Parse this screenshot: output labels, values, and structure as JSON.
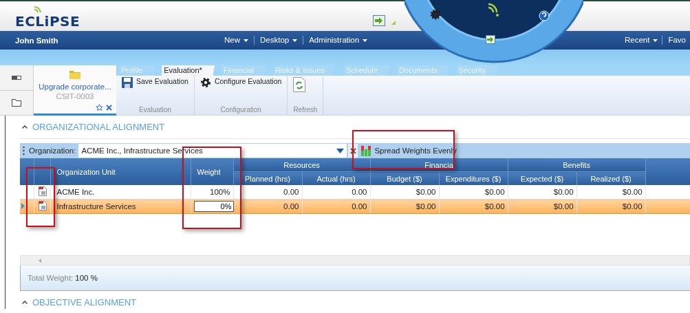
{
  "header": {
    "logo": "ECLiPSE"
  },
  "nav": {
    "user": "John Smith",
    "menus": [
      {
        "label": "New"
      },
      {
        "label": "Desktop"
      },
      {
        "label": "Administration"
      }
    ],
    "right_menus": [
      {
        "label": "Recent"
      },
      {
        "label": "Favo"
      }
    ]
  },
  "record": {
    "title": "Upgrade corporate...",
    "code": "CSIT-0003"
  },
  "tabs": [
    {
      "label": "Profile",
      "selected": false
    },
    {
      "label": "Evaluation*",
      "selected": true
    },
    {
      "label": "Financial",
      "selected": false
    },
    {
      "label": "Risks & Issues",
      "selected": false
    },
    {
      "label": "Schedule",
      "selected": false
    },
    {
      "label": "Documents",
      "selected": false
    },
    {
      "label": "Security",
      "selected": false
    }
  ],
  "ribbon_groups": [
    {
      "label": "Evaluation",
      "buttons": [
        {
          "label": "Save Evaluation",
          "kind": "save"
        }
      ]
    },
    {
      "label": "Configuration",
      "buttons": [
        {
          "label": "Configure Evaluation",
          "kind": "gear"
        }
      ]
    },
    {
      "label": "Refresh",
      "buttons": [
        {
          "kind": "refresh"
        }
      ]
    }
  ],
  "section": {
    "title": "ORGANIZATIONAL ALIGNMENT"
  },
  "toolbar": {
    "filter_label": "Organization:",
    "filter_value": "ACME Inc., Infrastructure Services",
    "action": "Spread Weights Evenly"
  },
  "table": {
    "columns": [
      {
        "label": "Organization Unit"
      },
      {
        "label": "Weight"
      },
      {
        "label": "Resources",
        "children": [
          {
            "label": "Planned (hrs)"
          },
          {
            "label": "Actual (hrs)"
          }
        ]
      },
      {
        "label": "Financia",
        "children": [
          {
            "label": "Budget ($)"
          },
          {
            "label": "Expenditures ($)"
          }
        ]
      },
      {
        "label": "Benefits",
        "children": [
          {
            "label": "Expected ($)"
          },
          {
            "label": "Realized ($)"
          }
        ]
      }
    ],
    "rows": [
      {
        "selected": false,
        "editing": false,
        "unit": "ACME Inc.",
        "weight": "100%",
        "values": [
          "0.00",
          "0.00",
          "$0.00",
          "$0.00",
          "$0.00",
          "$0.00"
        ]
      },
      {
        "selected": true,
        "editing": true,
        "unit": "Infrastructure Services",
        "weight": "0%",
        "values": [
          "0.00",
          "0.00",
          "$0.00",
          "$0.00",
          "$0.00",
          "$0.00"
        ]
      }
    ]
  },
  "footer": {
    "label": "Total Weight:",
    "value": "100 %"
  },
  "next_section": {
    "title": "OBJECTIVE ALIGNMENT"
  }
}
